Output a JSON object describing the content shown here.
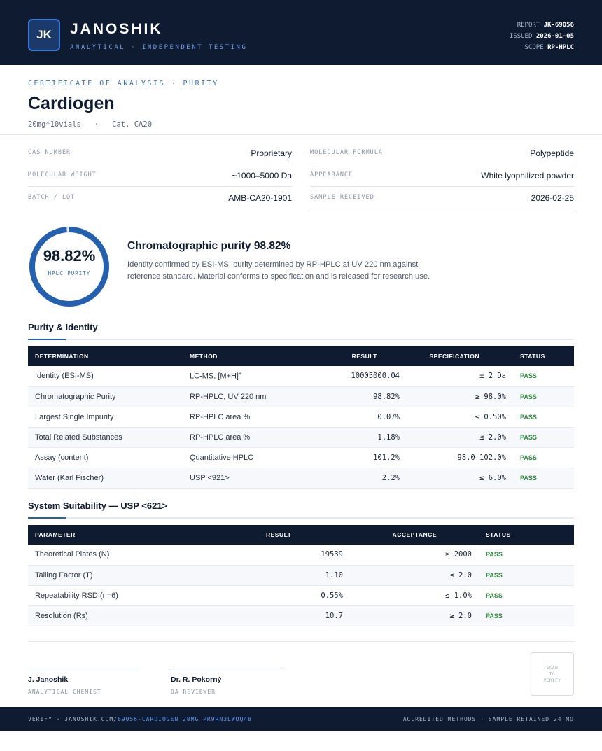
{
  "header": {
    "logo_initials": "JK",
    "brand": "JANOSHIK",
    "tagline": "ANALYTICAL · INDEPENDENT TESTING",
    "report_label": "REPORT",
    "report_value": "JK-69056",
    "issued_label": "ISSUED",
    "issued_value": "2026-01-05",
    "scope_label": "SCOPE",
    "scope_value": "RP-HPLC"
  },
  "title": {
    "kicker": "CERTIFICATE OF ANALYSIS · PURITY",
    "product": "Cardiogen",
    "spec": "20mg*10vials",
    "separator": "·",
    "catalog": "Cat. CA20"
  },
  "properties": {
    "left": [
      {
        "label": "CAS NUMBER",
        "value": "Proprietary"
      },
      {
        "label": "MOLECULAR WEIGHT",
        "value": "~1000–5000 Da"
      },
      {
        "label": "BATCH / LOT",
        "value": "AMB-CA20-1901"
      }
    ],
    "right": [
      {
        "label": "MOLECULAR FORMULA",
        "value": "Polypeptide"
      },
      {
        "label": "APPEARANCE",
        "value": "White lyophilized powder"
      },
      {
        "label": "SAMPLE RECEIVED",
        "value": "2026-02-25"
      }
    ]
  },
  "purity": {
    "value_text": "98.82%",
    "fraction": 0.9882,
    "ring_label": "HPLC PURITY",
    "heading": "Chromatographic purity 98.82%",
    "description": "Identity confirmed by ESI-MS; purity determined by RP-HPLC at UV 220 nm against reference standard. Material conforms to specification and is released for research use.",
    "ring_color": "#2360b0"
  },
  "identity_section": {
    "title": "Purity & Identity",
    "columns": [
      "DETERMINATION",
      "METHOD",
      "RESULT",
      "SPECIFICATION",
      "STATUS"
    ],
    "rows": [
      {
        "determination": "Identity (ESI-MS)",
        "method": "LC-MS, [M+H]",
        "method_sup": "+",
        "result": "10005000.04",
        "spec": "± 2 Da",
        "status": "PASS"
      },
      {
        "determination": "Chromatographic Purity",
        "method": "RP-HPLC, UV 220 nm",
        "method_sup": "",
        "result": "98.82%",
        "spec": "≥ 98.0%",
        "status": "PASS"
      },
      {
        "determination": "Largest Single Impurity",
        "method": "RP-HPLC area %",
        "method_sup": "",
        "result": "0.07%",
        "spec": "≤ 0.50%",
        "status": "PASS"
      },
      {
        "determination": "Total Related Substances",
        "method": "RP-HPLC area %",
        "method_sup": "",
        "result": "1.18%",
        "spec": "≤ 2.0%",
        "status": "PASS"
      },
      {
        "determination": "Assay (content)",
        "method": "Quantitative HPLC",
        "method_sup": "",
        "result": "101.2%",
        "spec": "98.0–102.0%",
        "status": "PASS"
      },
      {
        "determination": "Water (Karl Fischer)",
        "method": "USP <921>",
        "method_sup": "",
        "result": "2.2%",
        "spec": "≤ 6.0%",
        "status": "PASS"
      }
    ]
  },
  "suitability_section": {
    "title": "System Suitability — USP <621>",
    "columns": [
      "PARAMETER",
      "RESULT",
      "ACCEPTANCE",
      "STATUS"
    ],
    "rows": [
      {
        "parameter": "Theoretical Plates (N)",
        "result": "19539",
        "acceptance": "≥ 2000",
        "status": "PASS"
      },
      {
        "parameter": "Tailing Factor (T)",
        "result": "1.10",
        "acceptance": "≤ 2.0",
        "status": "PASS"
      },
      {
        "parameter": "Repeatability RSD (n=6)",
        "result": "0.55%",
        "acceptance": "≤ 1.0%",
        "status": "PASS"
      },
      {
        "parameter": "Resolution (Rs)",
        "result": "10.7",
        "acceptance": "≥ 2.0",
        "status": "PASS"
      }
    ]
  },
  "signatures": [
    {
      "name": "J. Janoshik",
      "role": "ANALYTICAL CHEMIST"
    },
    {
      "name": "Dr. R. Pokorný",
      "role": "QA REVIEWER"
    }
  ],
  "qr": {
    "line1": "SCAN",
    "line2": "TO",
    "line3": "VERIFY"
  },
  "footer": {
    "verify_prefix": "VERIFY · JANOSHIK.COM/",
    "verify_link": "69056-CARDIOGEN_20MG_PR9RN3LWUQ48",
    "right": "ACCREDITED METHODS · SAMPLE RETAINED 24 MO"
  }
}
